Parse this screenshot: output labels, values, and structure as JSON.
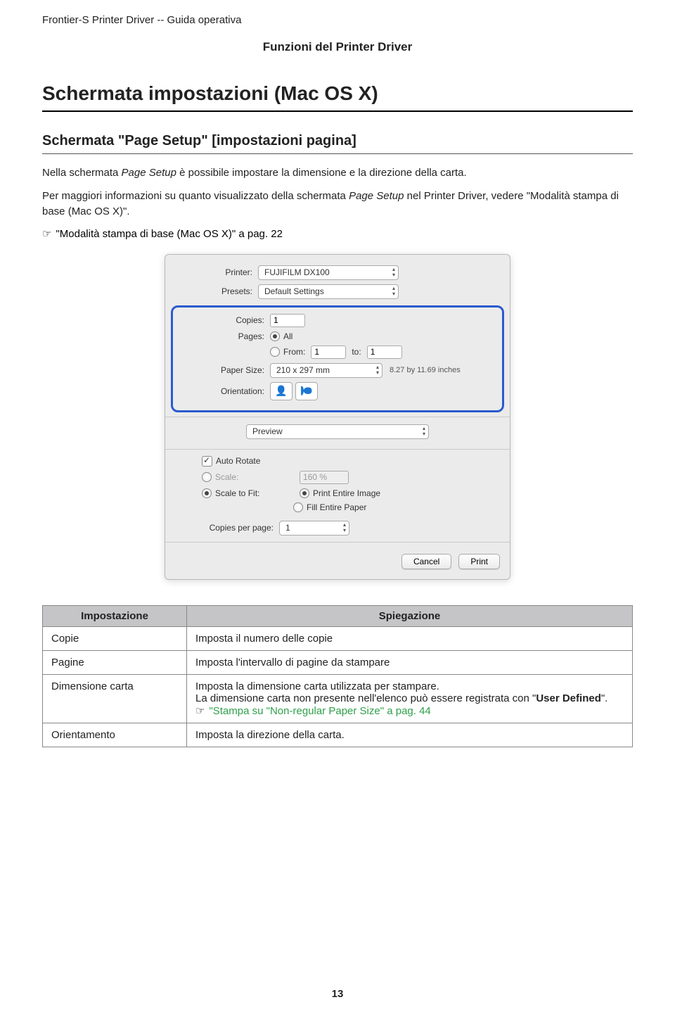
{
  "header": {
    "doc_title": "Frontier-S     Printer Driver -- Guida operativa",
    "chapter": "Funzioni del Printer Driver"
  },
  "section": {
    "h1": "Schermata impostazioni (Mac OS X)",
    "h2": "Schermata \"Page Setup\" [impostazioni pagina]",
    "p1a": "Nella schermata ",
    "p1b_italic": "Page Setup",
    "p1c": " è possibile impostare la dimensione e la direzione della carta.",
    "p2a": "Per maggiori informazioni su quanto visualizzato della schermata ",
    "p2b_italic": "Page Setup",
    "p2c": " nel Printer Driver, vedere \"Modalità stampa di base (Mac OS X)\".",
    "xref": "\"Modalità stampa di base (Mac OS X)\" a pag. 22"
  },
  "dialog": {
    "printer_label": "Printer:",
    "printer_value": "FUJIFILM DX100",
    "presets_label": "Presets:",
    "presets_value": "Default Settings",
    "copies_label": "Copies:",
    "copies_value": "1",
    "pages_label": "Pages:",
    "pages_all": "All",
    "pages_from": "From:",
    "pages_from_value": "1",
    "pages_to": "to:",
    "pages_to_value": "1",
    "papersize_label": "Paper Size:",
    "papersize_value": "210 x 297 mm",
    "papersize_hint": "8.27 by 11.69 inches",
    "orientation_label": "Orientation:",
    "preview_label": "Preview",
    "autorotate": "Auto Rotate",
    "scale_label": "Scale:",
    "scale_value": "160 %",
    "scaletofit": "Scale to Fit:",
    "print_entire": "Print Entire Image",
    "fill_entire": "Fill Entire Paper",
    "copies_per_page": "Copies per page:",
    "copies_per_page_value": "1",
    "cancel": "Cancel",
    "print": "Print"
  },
  "table": {
    "header_left": "Impostazione",
    "header_right": "Spiegazione",
    "rows": [
      {
        "label": "Copie",
        "desc": "Imposta il numero delle copie"
      },
      {
        "label": "Pagine",
        "desc": "Imposta l'intervallo di pagine da stampare"
      },
      {
        "label": "Dimensione carta",
        "desc_line1": "Imposta la dimensione carta utilizzata per stampare.",
        "desc_line2a": "La dimensione carta non presente nell'elenco può essere registrata con \"",
        "desc_line2b_bold": "User Defined",
        "desc_line2c": "\".",
        "desc_xref": "\"Stampa su \"Non-regular Paper Size\" a pag. 44"
      },
      {
        "label": "Orientamento",
        "desc": "Imposta la direzione della carta."
      }
    ]
  },
  "page_number": "13"
}
